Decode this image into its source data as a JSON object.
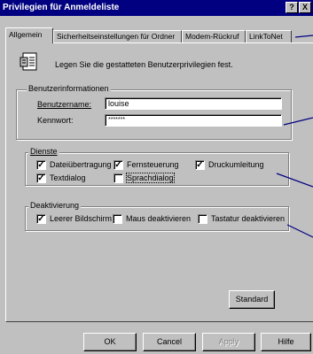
{
  "window": {
    "title": "Privilegien für Anmeldeliste",
    "help_glyph": "?",
    "close_glyph": "X"
  },
  "tabs": [
    {
      "label": "Allgemein",
      "active": true
    },
    {
      "label": "Sicherheitseinstellungen für Ordner",
      "active": false
    },
    {
      "label": "Modem-Rückruf",
      "active": false
    },
    {
      "label": "LinkToNet",
      "active": false
    }
  ],
  "intro": {
    "icon": "document-list-icon",
    "text": "Legen Sie die gestatteten Benutzerprivilegien fest."
  },
  "user_info": {
    "legend": "Benutzerinformationen",
    "username_label": "Benutzername:",
    "username_value": "louise",
    "password_label": "Kennwort:",
    "password_value": "*******"
  },
  "services": {
    "legend": "Dienste",
    "items": [
      {
        "label": "Dateiübertragung",
        "checked": true
      },
      {
        "label": "Fernsteuerung",
        "checked": true
      },
      {
        "label": "Druckumleitung",
        "checked": true
      },
      {
        "label": "Textdialog",
        "checked": true
      },
      {
        "label": "Sprachdialog",
        "checked": false
      }
    ]
  },
  "deactivation": {
    "legend": "Deaktivierung",
    "items": [
      {
        "label": "Leerer Bildschirm",
        "checked": true
      },
      {
        "label": "Maus deaktivieren",
        "checked": false
      },
      {
        "label": "Tastatur deaktivieren",
        "checked": false
      }
    ]
  },
  "buttons": {
    "standard": "Standard",
    "ok": "OK",
    "cancel": "Cancel",
    "apply": "Apply",
    "help": "Hilfe"
  },
  "colors": {
    "titlebar": "#000080",
    "face": "#c0c0c0",
    "callout": "#000080"
  }
}
